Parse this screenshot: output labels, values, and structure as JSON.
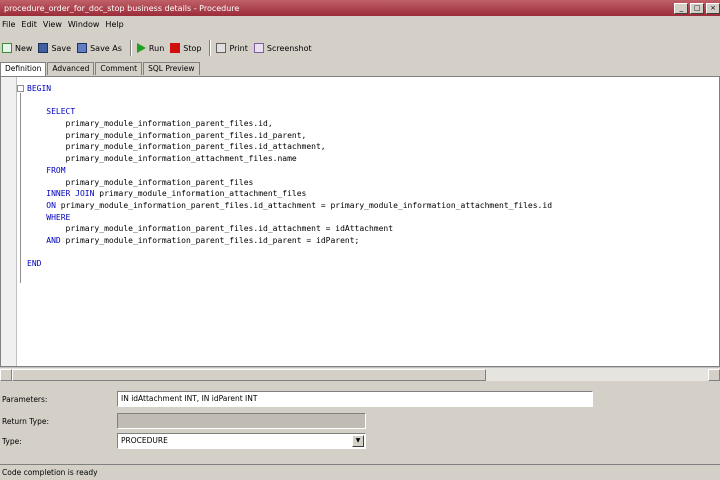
{
  "window": {
    "title": "procedure_order_for_doc_stop business details - Procedure",
    "minimize": "_",
    "maximize": "□",
    "close": "×"
  },
  "menu": [
    "File",
    "Edit",
    "View",
    "Window",
    "Help"
  ],
  "toolbar": {
    "new": "New",
    "save": "Save",
    "save_as": "Save As",
    "run": "Run",
    "stop": "Stop",
    "print": "Print",
    "export": "Screenshot"
  },
  "tabs": [
    "Definition",
    "Advanced",
    "Comment",
    "SQL Preview"
  ],
  "code": {
    "lines": [
      {
        "indent": 0,
        "kw": "BEGIN",
        "text": ""
      },
      {
        "indent": 0,
        "kw": "",
        "text": ""
      },
      {
        "indent": 1,
        "kw": "SELECT",
        "text": ""
      },
      {
        "indent": 2,
        "kw": "",
        "text": "primary_module_information_parent_files.id,"
      },
      {
        "indent": 2,
        "kw": "",
        "text": "primary_module_information_parent_files.id_parent,"
      },
      {
        "indent": 2,
        "kw": "",
        "text": "primary_module_information_parent_files.id_attachment,"
      },
      {
        "indent": 2,
        "kw": "",
        "text": "primary_module_information_attachment_files.name"
      },
      {
        "indent": 1,
        "kw": "FROM",
        "text": ""
      },
      {
        "indent": 2,
        "kw": "",
        "text": "primary_module_information_parent_files"
      },
      {
        "indent": 1,
        "kw": "INNER JOIN",
        "text": "primary_module_information_attachment_files"
      },
      {
        "indent": 1,
        "kw": "ON",
        "text": "primary_module_information_parent_files.id_attachment = primary_module_information_attachment_files.id"
      },
      {
        "indent": 1,
        "kw": "WHERE",
        "text": ""
      },
      {
        "indent": 2,
        "kw": "",
        "text": "primary_module_information_parent_files.id_attachment = idAttachment"
      },
      {
        "indent": 1,
        "kw": "AND",
        "text": "primary_module_information_parent_files.id_parent = idParent;"
      },
      {
        "indent": 0,
        "kw": "",
        "text": ""
      },
      {
        "indent": 0,
        "kw": "END",
        "text": ""
      }
    ]
  },
  "params": {
    "parameters_label": "Parameters:",
    "parameters_value": "IN idAttachment INT, IN idParent INT",
    "return_type_label": "Return Type:",
    "return_type_value": "",
    "type_label": "Type:",
    "type_value": "PROCEDURE"
  },
  "status": {
    "text": "Code completion is ready"
  }
}
